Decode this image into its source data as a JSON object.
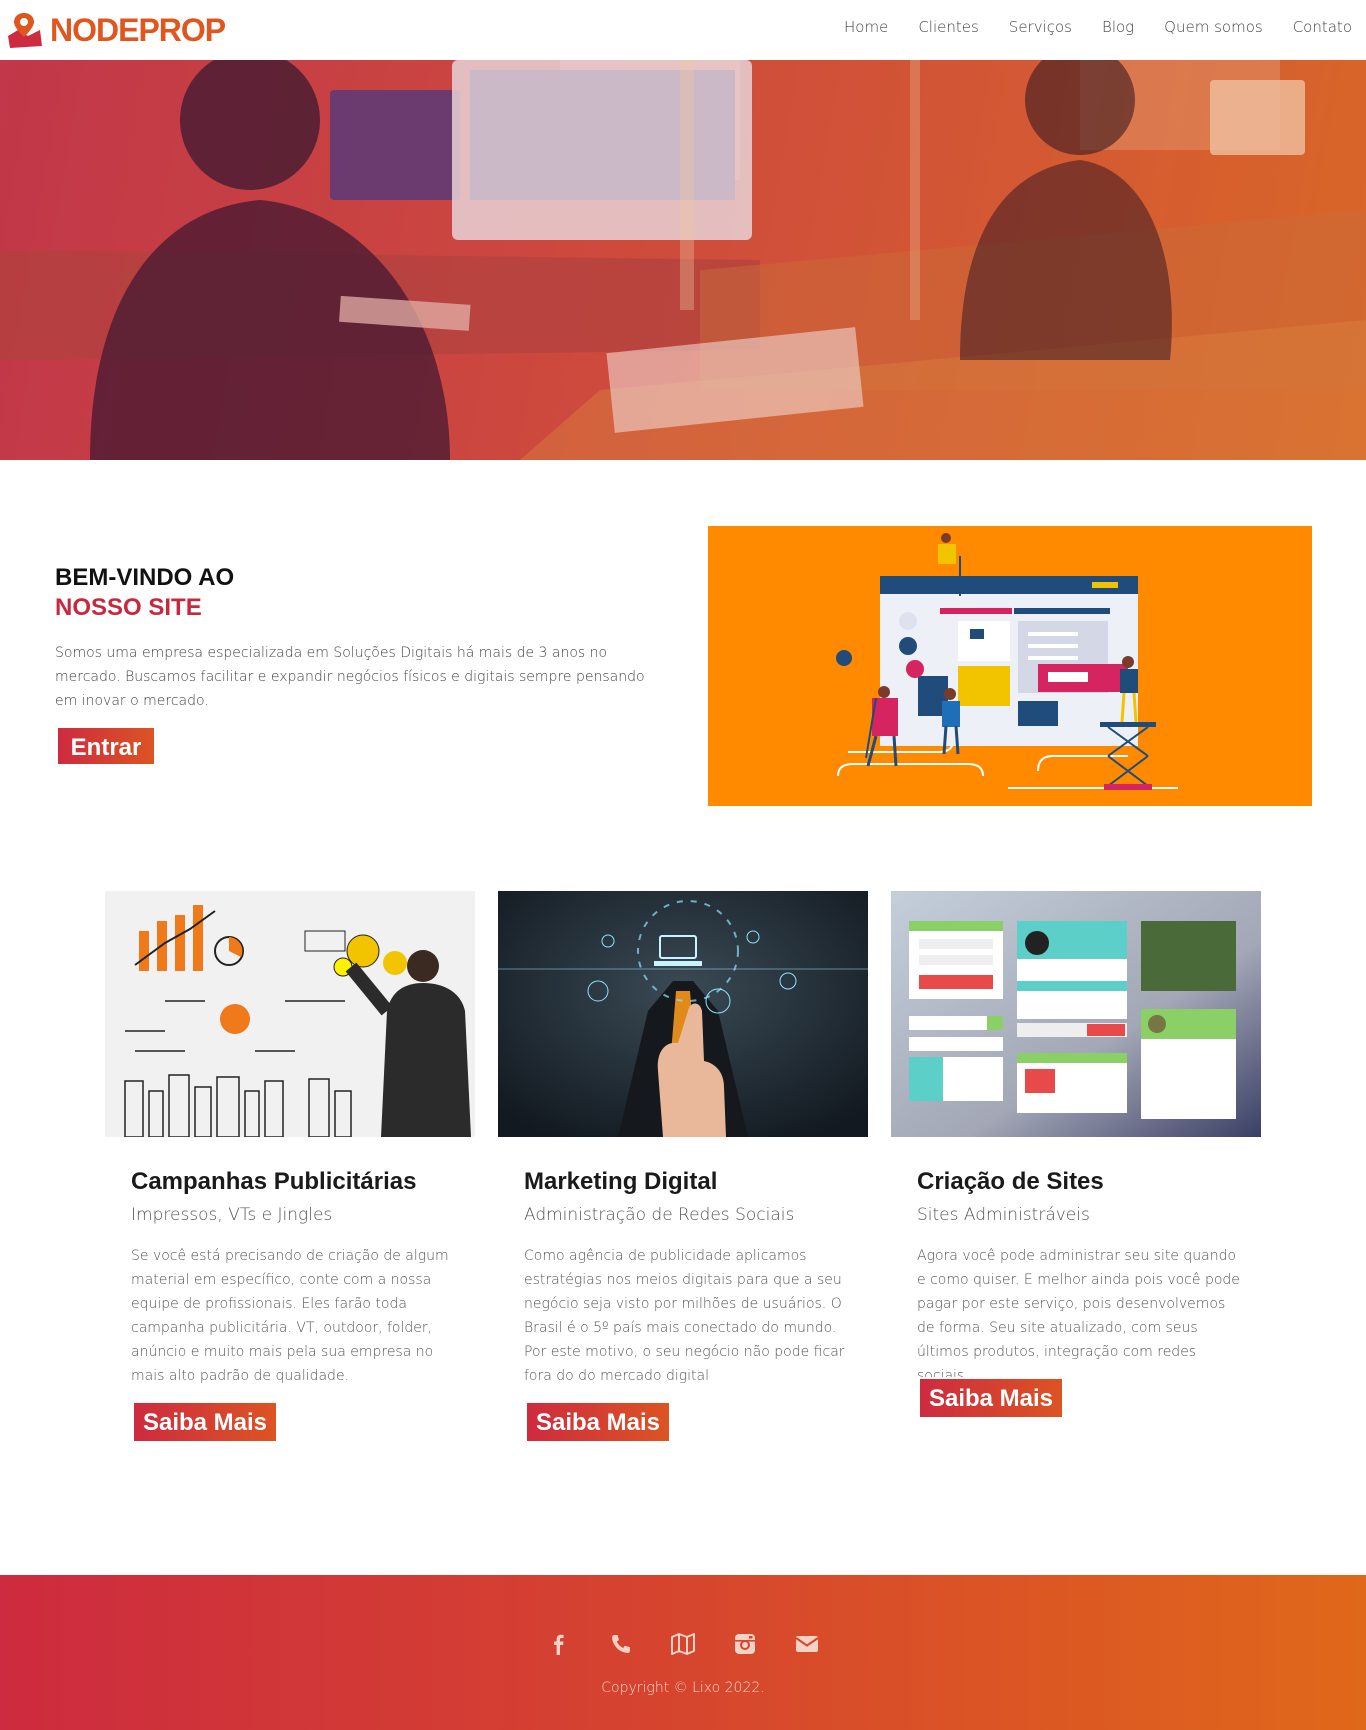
{
  "brand": {
    "name": "NODEPROP",
    "logo_icon": "map-pin-logo-icon",
    "color": "#e0561f"
  },
  "nav": {
    "items": [
      {
        "label": "Home"
      },
      {
        "label": "Clientes"
      },
      {
        "label": "Serviços"
      },
      {
        "label": "Blog"
      },
      {
        "label": "Quem somos"
      },
      {
        "label": "Contato"
      }
    ]
  },
  "hero": {
    "image": "office-workspace-photo"
  },
  "welcome": {
    "title_line1": "BEM-VINDO AO",
    "title_line2": "NOSSO SITE",
    "text": "Somos uma empresa especializada em Soluções Digitais há mais de 3 anos no mercado. Buscamos facilitar e expandir negócios físicos e digitais sempre pensando em inovar o mercado.",
    "button_label": "Entrar",
    "illustration": "web-design-team-illustration"
  },
  "services": [
    {
      "title": "Campanhas Publicitárias",
      "subtitle": "Impressos, VTs e Jingles",
      "text": "Se você está precisando de criação de algum material em específico, conte com a nossa equipe de profissionais. Eles farão toda campanha publicitária. VT, outdoor, folder, anúncio e muito mais pela sua empresa no mais alto padrão de qualidade.",
      "button_label": "Saiba Mais",
      "image": "businessman-whiteboard-sketch-photo"
    },
    {
      "title": "Marketing Digital",
      "subtitle": "Administração de Redes Sociais",
      "text": "Como agência de publicidade aplicamos estratégias nos meios digitais para que a seu negócio seja visto por milhões de usuários. O Brasil é o 5º país mais conectado do mundo. Por este motivo, o seu negócio não pode ficar fora do do mercado digital",
      "button_label": "Saiba Mais",
      "image": "finger-touching-digital-icons-photo"
    },
    {
      "title": "Criação de Sites",
      "subtitle": "Sites Administráveis",
      "text": "Agora você pode administrar seu site quando e como quiser. E melhor ainda pois você pode pagar por este serviço, pois desenvolvemos de forma. Seu site atualizado, com seus últimos produtos, integração com redes sociais.",
      "button_label": "Saiba Mais",
      "image": "ui-kit-widgets-screenshot"
    }
  ],
  "footer": {
    "icons": [
      "facebook-icon",
      "phone-icon",
      "map-icon",
      "instagram-icon",
      "envelope-icon"
    ],
    "copyright": "Copyright © Lixo 2022."
  },
  "colors": {
    "accent_red": "#cd2b3f",
    "accent_orange": "#e0681a",
    "illustration_bg": "#ff8a00"
  }
}
